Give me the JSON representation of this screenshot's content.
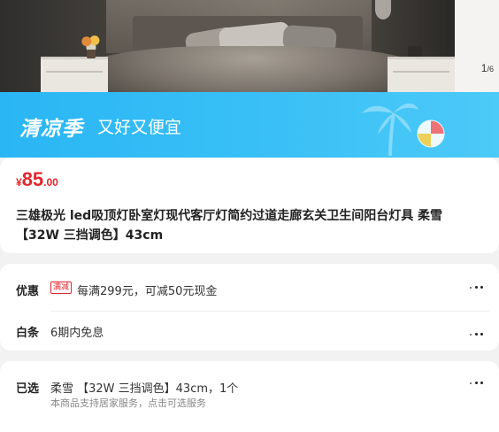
{
  "gallery": {
    "current": "1",
    "total": "/6"
  },
  "promo": {
    "brand": "清凉季",
    "slogan": "又好又便宜",
    "color": "#2ab6f4"
  },
  "price": {
    "currency": "¥",
    "integer": "85",
    "decimal": ".00",
    "color": "#e4262d"
  },
  "product": {
    "title": "三雄极光 led吸顶灯卧室灯现代客厅灯简约过道走廊玄关卫生间阳台灯具 柔雪 【32W 三挡调色】43cm"
  },
  "offers": {
    "discount": {
      "label": "优惠",
      "tag": "满减",
      "text": "每满299元，可减50元现金"
    },
    "installment": {
      "label": "白条",
      "text": "6期内免息"
    }
  },
  "selected": {
    "label": "已选",
    "value": "柔雪 【32W 三挡调色】43cm，1个",
    "service": "本商品支持居家服务，点击可选服务"
  },
  "icons": {
    "more": "more-dots-icon",
    "palm": "palm-tree-icon",
    "ball": "beach-ball-icon"
  }
}
